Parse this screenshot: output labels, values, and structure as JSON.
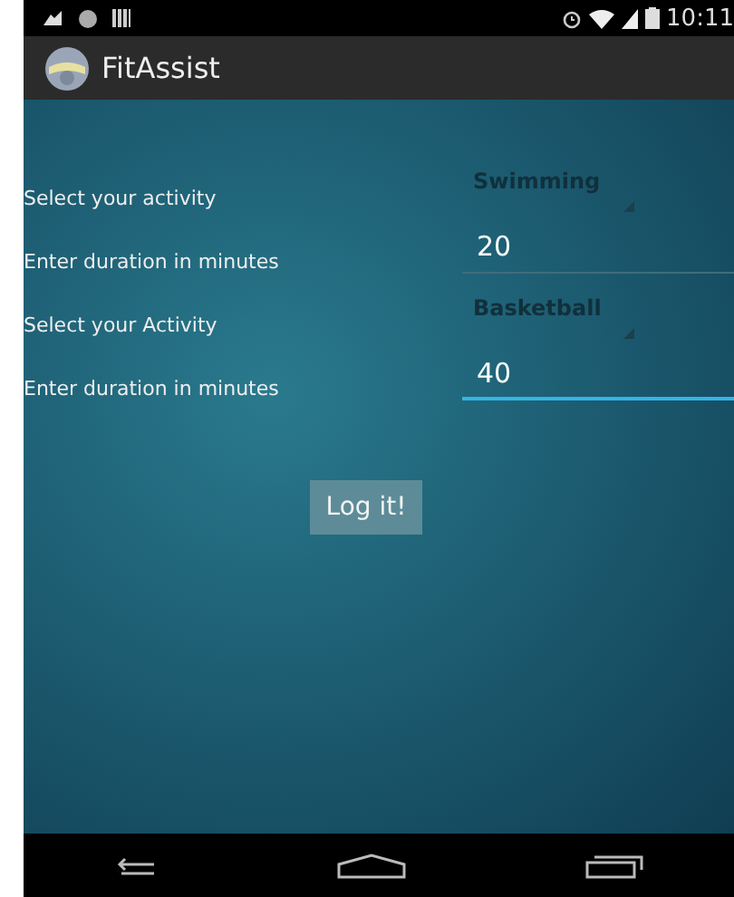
{
  "status_bar": {
    "time": "10:11"
  },
  "action_bar": {
    "title": "FitAssist"
  },
  "form": [
    {
      "kind": "spinner",
      "label": "Select your activity",
      "value": "Swimming"
    },
    {
      "kind": "field",
      "label": "Enter duration in minutes",
      "value": "20",
      "focused": false
    },
    {
      "kind": "spinner",
      "label": "Select your Activity",
      "value": "Basketball"
    },
    {
      "kind": "field",
      "label": "Enter duration in minutes",
      "value": "40",
      "focused": true
    }
  ],
  "button": "Log it!"
}
